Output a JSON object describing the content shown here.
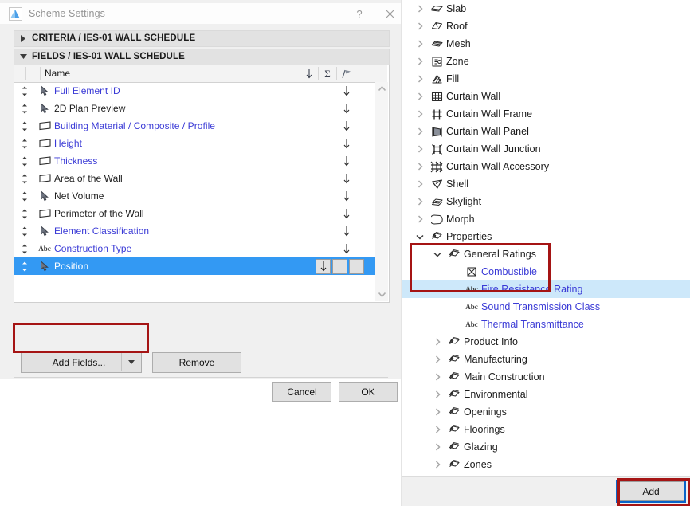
{
  "dialog": {
    "title": "Scheme Settings",
    "logo_icon": "archicad-logo-icon",
    "help_label": "?",
    "close_icon": "close-icon",
    "sections": [
      {
        "id": "criteria",
        "label": "CRITERIA / IES-01 WALL SCHEDULE",
        "expanded": false
      },
      {
        "id": "fields",
        "label": "FIELDS / IES-01 WALL SCHEDULE",
        "expanded": true
      }
    ],
    "table": {
      "header": {
        "name_column": "Name",
        "icons": [
          "sort-arrow-icon",
          "sum-sigma-icon",
          "flag-icon"
        ]
      },
      "rows": [
        {
          "name": "Full Element ID",
          "icon": "cursor-icon",
          "blue": true,
          "sorted": true,
          "selected": false
        },
        {
          "name": "2D Plan Preview",
          "icon": "cursor-icon",
          "blue": false,
          "sorted": true,
          "selected": false
        },
        {
          "name": "Building Material / Composite / Profile",
          "icon": "wall-icon",
          "blue": true,
          "sorted": true,
          "selected": false
        },
        {
          "name": "Height",
          "icon": "wall-icon",
          "blue": true,
          "sorted": true,
          "selected": false
        },
        {
          "name": "Thickness",
          "icon": "wall-icon",
          "blue": true,
          "sorted": true,
          "selected": false
        },
        {
          "name": "Area of the Wall",
          "icon": "wall-icon",
          "blue": false,
          "sorted": true,
          "selected": false
        },
        {
          "name": "Net Volume",
          "icon": "cursor-icon",
          "blue": false,
          "sorted": true,
          "selected": false
        },
        {
          "name": "Perimeter of the Wall",
          "icon": "wall-icon",
          "blue": false,
          "sorted": true,
          "selected": false
        },
        {
          "name": "Element Classification",
          "icon": "cursor-icon",
          "blue": true,
          "sorted": true,
          "selected": false
        },
        {
          "name": "Construction Type",
          "icon": "abc-text-icon",
          "blue": true,
          "sorted": true,
          "selected": false
        },
        {
          "name": "Position",
          "icon": "cursor-icon",
          "blue": true,
          "sorted": false,
          "selected": true
        }
      ]
    },
    "buttons": {
      "add_fields": "Add Fields...",
      "add_fields_dropdown_icon": "chevron-down-icon",
      "remove": "Remove",
      "cancel": "Cancel",
      "ok": "OK"
    },
    "scrollbar": {
      "up_icon": "chevron-up-icon",
      "down_icon": "chevron-down-icon"
    }
  },
  "right_panel": {
    "tree": [
      {
        "label": "Slab",
        "icon": "slab-icon",
        "level": 1,
        "twisty": "collapsed",
        "blue": false,
        "highlighted": false
      },
      {
        "label": "Roof",
        "icon": "roof-icon",
        "level": 1,
        "twisty": "collapsed",
        "blue": false,
        "highlighted": false
      },
      {
        "label": "Mesh",
        "icon": "mesh-icon",
        "level": 1,
        "twisty": "collapsed",
        "blue": false,
        "highlighted": false
      },
      {
        "label": "Zone",
        "icon": "zone-icon",
        "level": 1,
        "twisty": "collapsed",
        "blue": false,
        "highlighted": false
      },
      {
        "label": "Fill",
        "icon": "fill-icon",
        "level": 1,
        "twisty": "collapsed",
        "blue": false,
        "highlighted": false
      },
      {
        "label": "Curtain Wall",
        "icon": "curtainwall-icon",
        "level": 1,
        "twisty": "collapsed",
        "blue": false,
        "highlighted": false
      },
      {
        "label": "Curtain Wall Frame",
        "icon": "cw-frame-icon",
        "level": 1,
        "twisty": "collapsed",
        "blue": false,
        "highlighted": false
      },
      {
        "label": "Curtain Wall Panel",
        "icon": "cw-panel-icon",
        "level": 1,
        "twisty": "collapsed",
        "blue": false,
        "highlighted": false
      },
      {
        "label": "Curtain Wall Junction",
        "icon": "cw-junction-icon",
        "level": 1,
        "twisty": "collapsed",
        "blue": false,
        "highlighted": false
      },
      {
        "label": "Curtain Wall Accessory",
        "icon": "cw-accessory-icon",
        "level": 1,
        "twisty": "collapsed",
        "blue": false,
        "highlighted": false
      },
      {
        "label": "Shell",
        "icon": "shell-icon",
        "level": 1,
        "twisty": "collapsed",
        "blue": false,
        "highlighted": false
      },
      {
        "label": "Skylight",
        "icon": "skylight-icon",
        "level": 1,
        "twisty": "collapsed",
        "blue": false,
        "highlighted": false
      },
      {
        "label": "Morph",
        "icon": "morph-icon",
        "level": 1,
        "twisty": "collapsed",
        "blue": false,
        "highlighted": false
      },
      {
        "label": "Properties",
        "icon": "property-tag-icon",
        "level": 1,
        "twisty": "expanded",
        "blue": false,
        "highlighted": false
      },
      {
        "label": "General Ratings",
        "icon": "property-tag-icon",
        "level": 2,
        "twisty": "expanded",
        "blue": false,
        "highlighted": false
      },
      {
        "label": "Combustible",
        "icon": "checkbox-x-icon",
        "level": 3,
        "twisty": "none",
        "blue": true,
        "highlighted": false
      },
      {
        "label": "Fire Resistance Rating",
        "icon": "abc-text-icon",
        "level": 3,
        "twisty": "none",
        "blue": true,
        "highlighted": true
      },
      {
        "label": "Sound Transmission Class",
        "icon": "abc-text-icon",
        "level": 3,
        "twisty": "none",
        "blue": true,
        "highlighted": false
      },
      {
        "label": "Thermal Transmittance",
        "icon": "abc-text-icon",
        "level": 3,
        "twisty": "none",
        "blue": true,
        "highlighted": false
      },
      {
        "label": "Product Info",
        "icon": "property-tag-icon",
        "level": 2,
        "twisty": "collapsed",
        "blue": false,
        "highlighted": false
      },
      {
        "label": "Manufacturing",
        "icon": "property-tag-icon",
        "level": 2,
        "twisty": "collapsed",
        "blue": false,
        "highlighted": false
      },
      {
        "label": "Main Construction",
        "icon": "property-tag-icon",
        "level": 2,
        "twisty": "collapsed",
        "blue": false,
        "highlighted": false
      },
      {
        "label": "Environmental",
        "icon": "property-tag-icon",
        "level": 2,
        "twisty": "collapsed",
        "blue": false,
        "highlighted": false
      },
      {
        "label": "Openings",
        "icon": "property-tag-icon",
        "level": 2,
        "twisty": "collapsed",
        "blue": false,
        "highlighted": false
      },
      {
        "label": "Floorings",
        "icon": "property-tag-icon",
        "level": 2,
        "twisty": "collapsed",
        "blue": false,
        "highlighted": false
      },
      {
        "label": "Glazing",
        "icon": "property-tag-icon",
        "level": 2,
        "twisty": "collapsed",
        "blue": false,
        "highlighted": false
      },
      {
        "label": "Zones",
        "icon": "property-tag-icon",
        "level": 2,
        "twisty": "collapsed",
        "blue": false,
        "highlighted": false
      }
    ],
    "add_button": "Add"
  },
  "colors": {
    "selection_blue": "#3399f3",
    "highlight_blue": "#cde8fa",
    "link_blue": "#3a3ad6",
    "annotation_red": "#a51414",
    "focus_blue": "#0a64c8",
    "dialog_gray": "#f0f0f0"
  }
}
